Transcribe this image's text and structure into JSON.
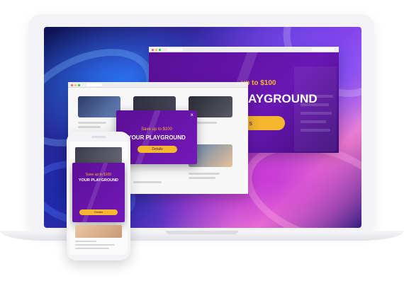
{
  "desktop_popup": {
    "headline_partial": "up to $100",
    "title_partial": "AYGROUND",
    "button_partial": "s"
  },
  "tablet_popup": {
    "headline": "Save up to $100",
    "title": "YOUR PLAYGROUND",
    "button": "Details",
    "close": "×"
  },
  "mobile_popup": {
    "headline": "Save up to $100",
    "title": "YOUR PLAYGROUND",
    "button": "Details"
  },
  "colors": {
    "popup_purple": "#6a17b4",
    "button_orange": "#f6b72e",
    "device_frame": "#f3f3f6"
  }
}
